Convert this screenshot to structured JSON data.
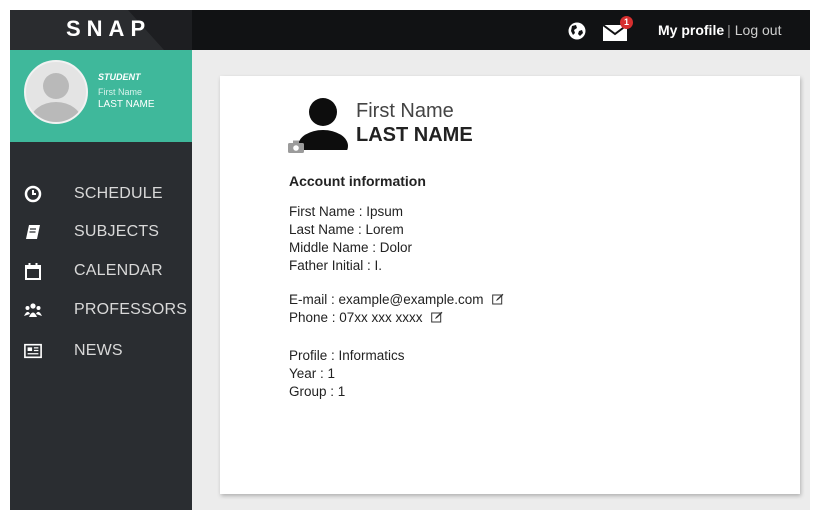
{
  "app": {
    "logo": "SNAP"
  },
  "topbar": {
    "notification_count": "1",
    "my_profile_label": "My profile",
    "separator": "|",
    "logout_label": "Log out",
    "icons": [
      "globe-icon",
      "mail-icon"
    ]
  },
  "sidebar": {
    "user": {
      "role": "STUDENT",
      "first_name": "First Name",
      "last_name": "LAST NAME"
    },
    "items": [
      {
        "label": "SCHEDULE",
        "icon": "clock-icon"
      },
      {
        "label": "SUBJECTS",
        "icon": "book-icon"
      },
      {
        "label": "CALENDAR",
        "icon": "calendar-icon"
      },
      {
        "label": "PROFESSORS",
        "icon": "people-icon"
      },
      {
        "label": "NEWS",
        "icon": "newspaper-icon"
      }
    ]
  },
  "profile": {
    "first_name": "First Name",
    "last_name": "LAST NAME",
    "section_title": "Account information",
    "fields": {
      "first_name": "First Name : Ipsum",
      "last_name": "Last Name : Lorem",
      "middle_name": "Middle Name :  Dolor",
      "father_initial": "Father Initial : I.",
      "email": "E-mail : example@example.com",
      "phone": "Phone : 07xx xxx xxxx",
      "profile": "Profile : Informatics",
      "year": "Year : 1",
      "group": "Group : 1"
    }
  },
  "colors": {
    "topbar": "#111214",
    "sidebar": "#2a2d31",
    "accent": "#3fb89b",
    "badge": "#d62f2f",
    "background": "#ececec"
  }
}
